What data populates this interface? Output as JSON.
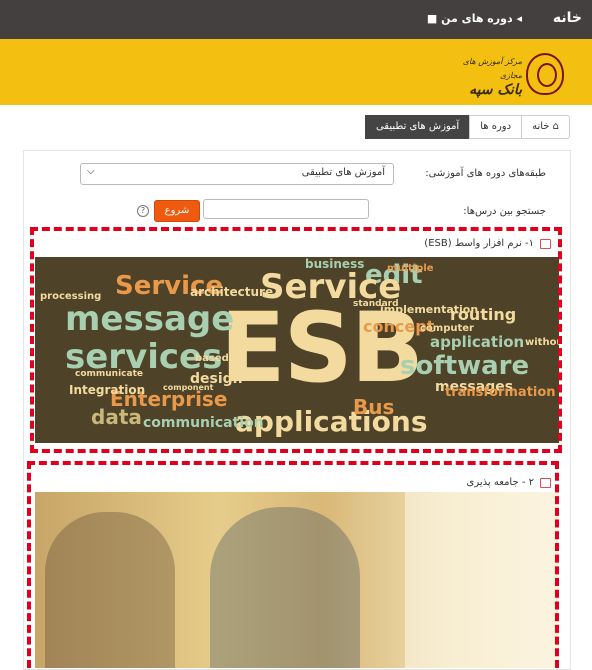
{
  "nav": {
    "home": "خانه",
    "my_courses": "دوره های من"
  },
  "brand": {
    "logo_line1": "مرکز آموزش های مجازی",
    "logo_line2": "بانک سپه"
  },
  "breadcrumb": [
    "خانه",
    "دوره ها",
    "آموزش های تطبیقی"
  ],
  "filter": {
    "label": "طبقه‌های دوره های آموزشی:",
    "selected": "آموزش های تطبیقی"
  },
  "search": {
    "label": "جستجو بین درس‌ها:",
    "value": "",
    "button": "شروع"
  },
  "courses": [
    {
      "title": "۱- نرم افزار واسط (ESB)"
    },
    {
      "title": "۲ - جامعه پذیری"
    }
  ],
  "wordcloud": [
    "ESB",
    "Service",
    "message",
    "services",
    "applications",
    "software",
    "Enterprise",
    "edit",
    "Bus",
    "architecture",
    "Integration",
    "data",
    "communication",
    "routing",
    "concept",
    "messages",
    "transformation",
    "application",
    "business",
    "processing",
    "design",
    "implementation",
    "standard",
    "communicate",
    "based",
    "component",
    "without",
    "multiple",
    "computer"
  ],
  "colors": {
    "topbar": "#43403f",
    "brand": "#f3c012",
    "accent": "#f05a0f",
    "highlight": "#e0001b"
  }
}
